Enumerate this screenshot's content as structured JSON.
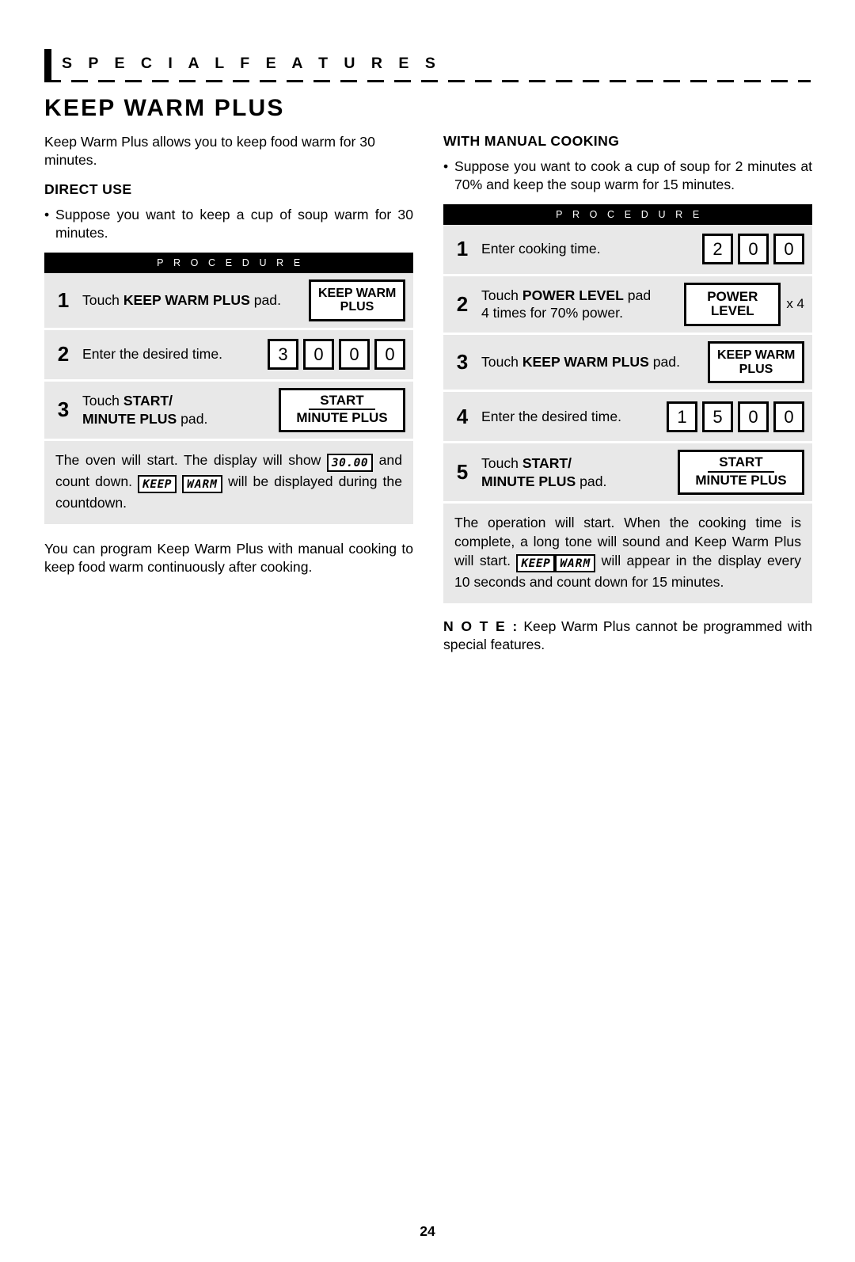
{
  "header": {
    "section_title": "S P E C I A L   F E A T U R E S"
  },
  "feature": {
    "title": "KEEP WARM PLUS",
    "intro": "Keep Warm Plus  allows you to keep food warm for 30 minutes."
  },
  "left_column": {
    "sub_head": "DIRECT USE",
    "bullet": "Suppose you want to keep a cup of soup warm for 30 minutes.",
    "procedure_header": "P R O C E D U R E",
    "steps": [
      {
        "num": "1",
        "text_prefix": "Touch ",
        "text_bold": "KEEP WARM PLUS",
        "text_suffix": " pad.",
        "pad_line1": "KEEP WARM",
        "pad_line2": "PLUS"
      },
      {
        "num": "2",
        "text": "Enter the desired time.",
        "digits": [
          "3",
          "0",
          "0",
          "0"
        ]
      },
      {
        "num": "3",
        "text_prefix": "Touch ",
        "text_bold": "START/",
        "text_bold2": "MINUTE PLUS",
        "text_suffix": " pad.",
        "pad_line1": "START",
        "pad_line2": "MINUTE PLUS"
      }
    ],
    "result_note": {
      "part1": "The oven will start. The display will show ",
      "lcd1": "30.00",
      "part2": " and count down. ",
      "lcd2": "KEEP",
      "lcd3": "WARM",
      "part3": " will be displayed during the countdown."
    },
    "closing_paragraph": "You can program Keep Warm Plus with manual cooking to keep food warm continuously after cooking."
  },
  "right_column": {
    "sub_head": "WITH MANUAL COOKING",
    "bullet": "Suppose you want to cook a cup of soup for 2 minutes at 70% and keep the soup warm for 15 minutes.",
    "procedure_header": "P R O C E D U R E",
    "steps": [
      {
        "num": "1",
        "text": "Enter cooking time.",
        "digits": [
          "2",
          "0",
          "0"
        ]
      },
      {
        "num": "2",
        "text_prefix": "Touch ",
        "text_bold": "POWER LEVEL",
        "text_suffix": " pad",
        "text_line2": "4 times for 70% power.",
        "pad_line1": "POWER",
        "pad_line2": "LEVEL",
        "multiplier": "x 4"
      },
      {
        "num": "3",
        "text_prefix": "Touch ",
        "text_bold": "KEEP WARM PLUS",
        "text_suffix": " pad.",
        "pad_line1": "KEEP WARM",
        "pad_line2": "PLUS"
      },
      {
        "num": "4",
        "text": "Enter the desired time.",
        "digits": [
          "1",
          "5",
          "0",
          "0"
        ]
      },
      {
        "num": "5",
        "text_prefix": "Touch ",
        "text_bold": "START/",
        "text_bold2": "MINUTE PLUS",
        "text_suffix": " pad.",
        "pad_line1": "START",
        "pad_line2": "MINUTE PLUS"
      }
    ],
    "result_note": {
      "part1": "The operation will start. When the cooking time is complete, a long tone will sound and Keep Warm Plus will start. ",
      "lcd1": "KEEP",
      "lcd2": "WARM",
      "part2": " will appear in the display every 10 seconds and count down for 15 minutes."
    },
    "final_note": {
      "label": "N O T E :",
      "text": " Keep Warm Plus cannot be programmed with special features."
    }
  },
  "footer": {
    "page_number": "24"
  }
}
